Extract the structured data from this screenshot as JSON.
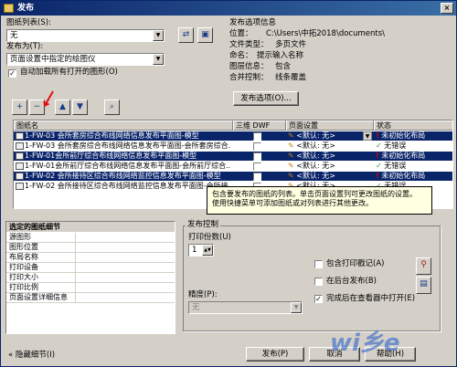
{
  "window": {
    "title": "发布"
  },
  "sheet_list": {
    "label": "图纸列表(S):",
    "value": "无"
  },
  "publish_to": {
    "label": "发布为(T):",
    "value": "页面设置中指定的绘图仪"
  },
  "auto_load": {
    "label": "自动加载所有打开的图形(O)",
    "checked": true
  },
  "publish_info": {
    "title": "发布选项信息",
    "location_label": "位置：",
    "location_value": "C:\\Users\\中拓2018\\documents\\",
    "filetype_label": "文件类型：",
    "filetype_value": "多页文件",
    "naming_label": "命名：",
    "naming_value": "提示输入名称",
    "layer_label": "图层信息：",
    "layer_value": "包含",
    "merge_label": "合并控制：",
    "merge_value": "线条覆盖",
    "options_button": "发布选项(O)..."
  },
  "table": {
    "headers": [
      "图纸名",
      "三维 DWF",
      "页面设置",
      "状态"
    ],
    "rows": [
      {
        "name": "1-FW-03 会所套房综合布线网络信息发布平面图-模型",
        "page_setup": "<默认: 无>",
        "status": "未初始化布局",
        "status_type": "warn",
        "selected": true
      },
      {
        "name": "1-FW-03 会所套房综合布线网络信息发布平面图-会所套房综合...",
        "page_setup": "<默认: 无>",
        "status": "无错误",
        "status_type": "ok",
        "selected": false
      },
      {
        "name": "1-FW-01会所前厅综合布线网络信息发布平面图-模型",
        "page_setup": "<默认: 无>",
        "status": "未初始化布局",
        "status_type": "warn",
        "selected": true
      },
      {
        "name": "1-FW-01会所前厅综合布线网络信息发布平面图-会所前厅综合...",
        "page_setup": "<默认: 无>",
        "status": "无错误",
        "status_type": "ok",
        "selected": false
      },
      {
        "name": "1-FW-02 会所接待区综合布线网络监控信息发布平面图-模型",
        "page_setup": "<默认: 无>",
        "status": "未初始化布局",
        "status_type": "warn",
        "selected": true
      },
      {
        "name": "1-FW-02 会所接待区综合布线网络监控信息发布平面图-会所接...",
        "page_setup": "<默认: 无>",
        "status": "无错误",
        "status_type": "ok",
        "selected": false
      }
    ]
  },
  "tooltip": {
    "line1": "包含要发布的图纸的列表。单击页面设置列可更改图纸的设置。",
    "line2": "使用快捷菜单可添加图纸或对列表进行其他更改。"
  },
  "sheet_details": {
    "title": "选定的图纸细节",
    "items": [
      "源图形",
      "图形位置",
      "布局名称",
      "打印设备",
      "打印大小",
      "打印比例",
      "页面设置详细信息"
    ]
  },
  "publish_control": {
    "title": "发布控制",
    "copies_label": "打印份数(U)",
    "copies_value": "1",
    "precision_label": "精度(P):",
    "precision_value": "无",
    "include_stamp": {
      "label": "包含打印戳记(A)",
      "checked": false
    },
    "background": {
      "label": "在后台发布(B)",
      "checked": false
    },
    "open_viewer": {
      "label": "完成后在查看器中打开(E)",
      "checked": true
    }
  },
  "footer": {
    "hide_details": "隐藏细节(I)",
    "publish_button": "发布(P)",
    "cancel_button": "取消",
    "help_button": "帮助(H)"
  },
  "watermark": {
    "text": "wi乡e"
  }
}
